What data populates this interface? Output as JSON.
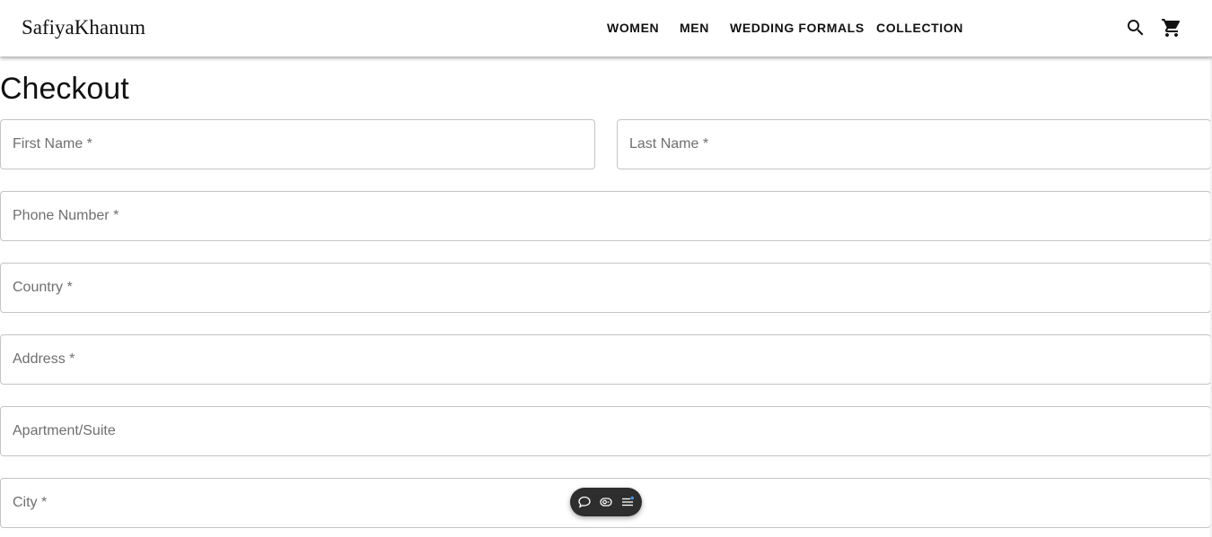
{
  "header": {
    "logo": "SafiyaKhanum",
    "nav": [
      {
        "label": "WOMEN"
      },
      {
        "label": "MEN"
      },
      {
        "label": "WEDDING FORMALS"
      },
      {
        "label": "COLLECTION"
      }
    ],
    "icons": {
      "search": "search-icon",
      "cart": "shopping-cart-icon"
    }
  },
  "page": {
    "title": "Checkout"
  },
  "form": {
    "first_name": {
      "placeholder": "First Name *",
      "value": ""
    },
    "last_name": {
      "placeholder": "Last Name *",
      "value": ""
    },
    "phone": {
      "placeholder": "Phone Number *",
      "value": ""
    },
    "country": {
      "placeholder": "Country *",
      "value": ""
    },
    "address": {
      "placeholder": "Address *",
      "value": ""
    },
    "apartment": {
      "placeholder": "Apartment/Suite",
      "value": ""
    },
    "city": {
      "placeholder": "City *",
      "value": ""
    }
  },
  "floating_toolbar": {
    "icons": [
      "chat-icon",
      "screen-capture-icon",
      "menu-notification-icon"
    ],
    "background": "#2e2e2e"
  },
  "colors": {
    "field_border": "#c4c4c4",
    "placeholder": "#6f6f6f",
    "text": "#111111"
  }
}
